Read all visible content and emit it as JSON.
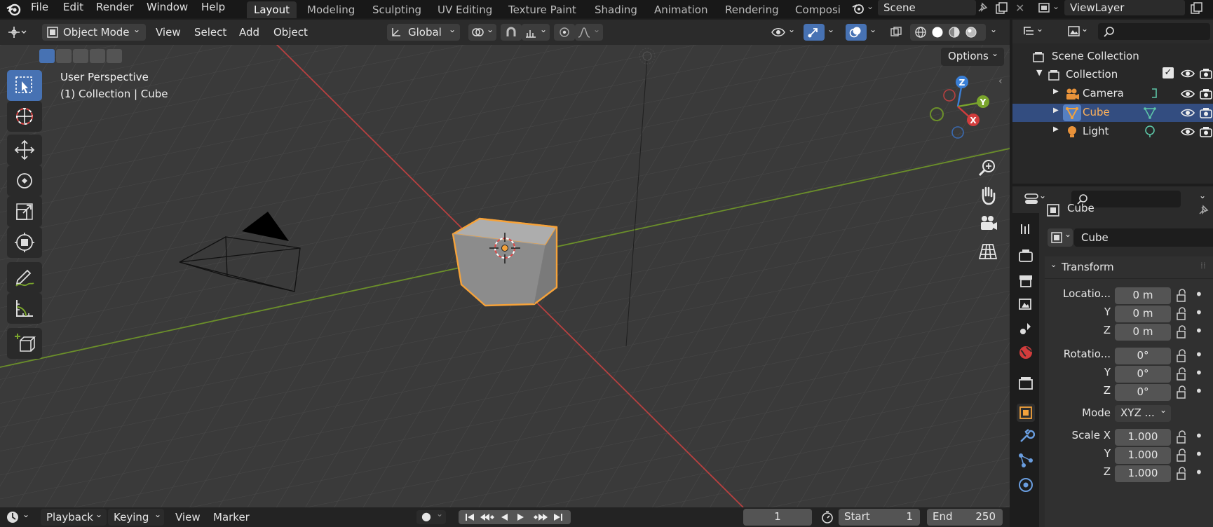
{
  "topbar": {
    "menus": [
      "File",
      "Edit",
      "Render",
      "Window",
      "Help"
    ],
    "workspaces": [
      "Layout",
      "Modeling",
      "Sculpting",
      "UV Editing",
      "Texture Paint",
      "Shading",
      "Animation",
      "Rendering",
      "Composi"
    ],
    "active_workspace": "Layout",
    "scene": "Scene",
    "view_layer": "ViewLayer"
  },
  "viewport_header": {
    "mode": "Object Mode",
    "menus": [
      "View",
      "Select",
      "Add",
      "Object"
    ],
    "transform_orientation": "Global"
  },
  "viewport": {
    "perspective": "User Perspective",
    "context": "(1) Collection | Cube",
    "options_label": "Options",
    "gizmo": {
      "x": "X",
      "y": "Y",
      "z": "Z"
    }
  },
  "timeline": {
    "menus": [
      "Playback",
      "Keying",
      "View",
      "Marker"
    ],
    "current_frame": "1",
    "start_label": "Start",
    "start_value": "1",
    "end_label": "End",
    "end_value": "250"
  },
  "outliner": {
    "root": "Scene Collection",
    "collection": "Collection",
    "items": [
      {
        "name": "Camera",
        "selected": false
      },
      {
        "name": "Cube",
        "selected": true
      },
      {
        "name": "Light",
        "selected": false
      }
    ]
  },
  "properties": {
    "object_name": "Cube",
    "data_name": "Cube",
    "panel_title": "Transform",
    "location_label": "Locatio...",
    "location": {
      "x": "0 m",
      "y": "0 m",
      "z": "0 m"
    },
    "rotation_label": "Rotatio...",
    "rotation": {
      "x": "0°",
      "y": "0°",
      "z": "0°"
    },
    "mode_label": "Mode",
    "mode_value": "XYZ ...",
    "scale_label": "Scale X",
    "scale": {
      "x": "1.000",
      "y": "1.000",
      "z": "1.000"
    },
    "axis_labels": {
      "y": "Y",
      "z": "Z"
    }
  },
  "colors": {
    "accent": "#4772b3",
    "selection": "#ffa030",
    "x_axis": "#d23c3c",
    "y_axis": "#7aa52c",
    "z_axis": "#3a7fd6"
  }
}
